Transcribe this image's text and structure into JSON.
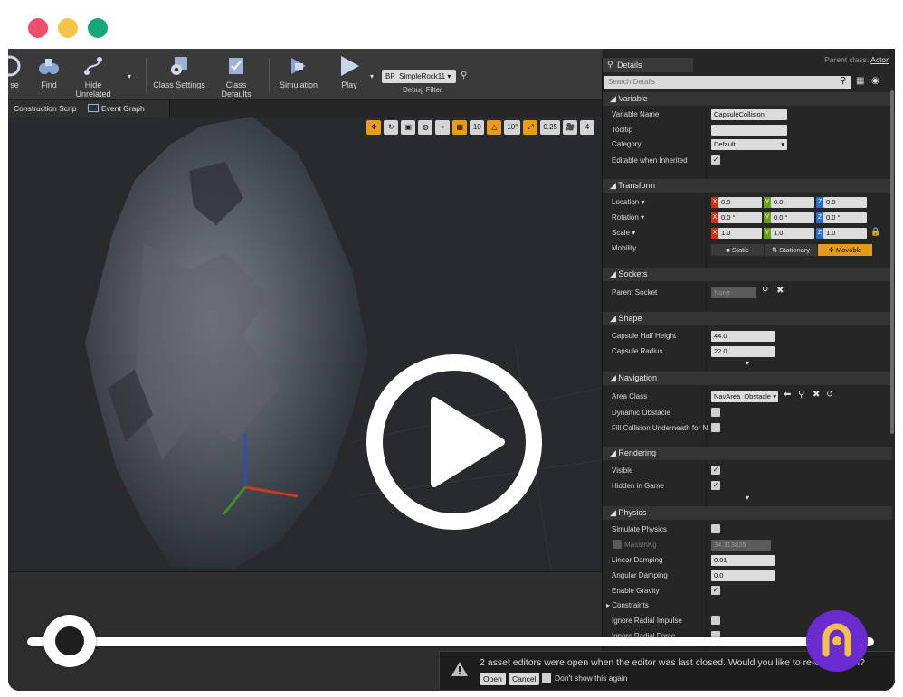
{
  "toolbar": {
    "browse_label": "se",
    "find_label": "Find",
    "hide_unrelated_label": "Hide Unrelated",
    "class_settings_label": "Class Settings",
    "class_defaults_label": "Class Defaults",
    "simulation_label": "Simulation",
    "play_label": "Play",
    "debug_object": "BP_SimpleRock11",
    "debug_filter_label": "Debug Filter"
  },
  "tabs": [
    "Construction Scrip",
    "Event Graph"
  ],
  "viewport_controls": {
    "grid_snap": "10",
    "rotation_snap": "10°",
    "scale_snap": "0.25",
    "camera_speed": "4"
  },
  "details": {
    "tab_label": "Details",
    "parent_class_label": "Parent class:",
    "parent_class_value": "Actor",
    "search_placeholder": "Search Details",
    "sections": {
      "variable": "Variable",
      "transform": "Transform",
      "sockets": "Sockets",
      "shape": "Shape",
      "navigation": "Navigation",
      "rendering": "Rendering",
      "physics": "Physics"
    },
    "variable": {
      "name_label": "Variable Name",
      "name_value": "CapsuleCollision",
      "tooltip_label": "Tooltip",
      "category_label": "Category",
      "category_value": "Default",
      "editable_label": "Editable when Inherited"
    },
    "transform": {
      "location_label": "Location",
      "rotation_label": "Rotation",
      "scale_label": "Scale",
      "mobility_label": "Mobility",
      "location": [
        "0.0",
        "0.0",
        "0.0"
      ],
      "rotation": [
        "0.0 °",
        "0.0 °",
        "0.0 °"
      ],
      "scale": [
        "1.0",
        "1.0",
        "1.0"
      ],
      "mobility_options": [
        "Static",
        "Stationary",
        "Movable"
      ],
      "mobility_selected": "Movable"
    },
    "sockets": {
      "parent_socket_label": "Parent Socket",
      "parent_socket_value": "None"
    },
    "shape": {
      "half_height_label": "Capsule Half Height",
      "half_height_value": "44.0",
      "radius_label": "Capsule Radius",
      "radius_value": "22.0"
    },
    "navigation": {
      "area_class_label": "Area Class",
      "area_class_value": "NavArea_Obstacle",
      "dynamic_obstacle_label": "Dynamic Obstacle",
      "fill_collision_label": "Fill Collision Underneath for N"
    },
    "rendering": {
      "visible_label": "Visible",
      "hidden_label": "Hidden in Game"
    },
    "physics": {
      "simulate_label": "Simulate Physics",
      "mass_label": "MassInKg",
      "mass_value": "34.313835",
      "linear_damping_label": "Linear Damping",
      "linear_damping_value": "0.01",
      "angular_damping_label": "Angular Damping",
      "angular_damping_value": "0.0",
      "gravity_label": "Enable Gravity",
      "constraints_label": "Constraints",
      "ignore_radial_impulse_label": "Ignore Radial Impulse",
      "ignore_radial_force_label": "Ignore Radial Force"
    }
  },
  "notification": {
    "message": "2 asset editors were open when the editor was last closed. Would you like to re-open them?",
    "open_label": "Open",
    "cancel_label": "Cancel",
    "dont_show_label": "Don't show this again"
  },
  "video": {
    "progress": 0.05
  },
  "colors": {
    "accent": "#e29a1f",
    "panel": "#262626",
    "brand": "#6a2bd0"
  }
}
